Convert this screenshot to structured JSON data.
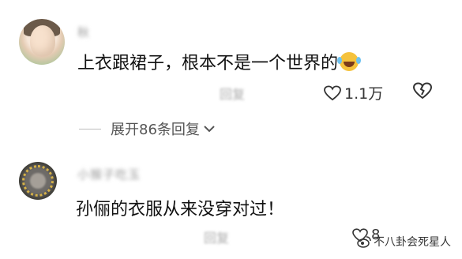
{
  "comments": [
    {
      "username": "秋",
      "text": "上衣跟裙子，根本不是一个世界的",
      "meta_time": "",
      "meta_reply": "回复",
      "likes": "1.1万",
      "emoji_icon": "rolling-laughing-emoji",
      "expand_replies": "展开86条回复"
    },
    {
      "username": "小猴子吃玉",
      "text": "孙俪的衣服从来没穿对过！",
      "meta_time": "",
      "meta_location": "",
      "meta_reply": "回复",
      "likes": "8"
    }
  ],
  "watermark": {
    "text": "不八卦会死星人",
    "icon": "weibo-logo-icon"
  },
  "colors": {
    "text": "#111111",
    "muted": "#9a9a9a",
    "icon": "#333333"
  }
}
